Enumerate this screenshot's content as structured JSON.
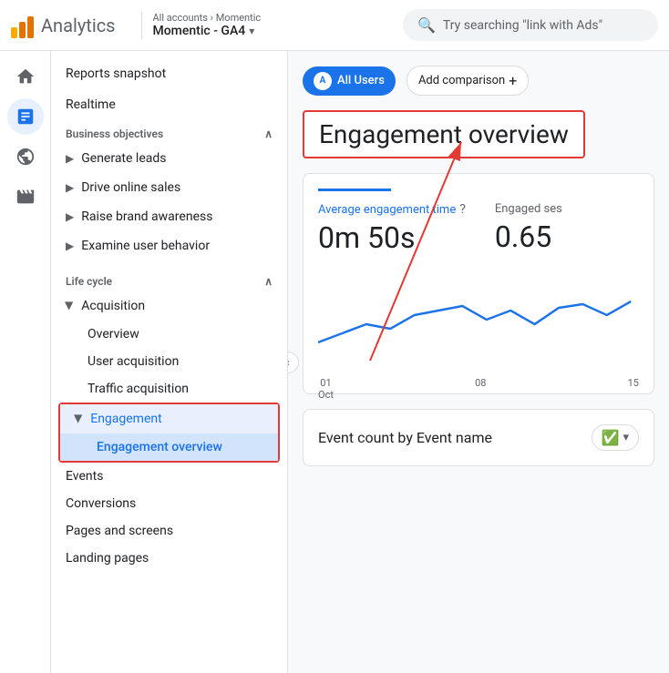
{
  "header": {
    "app_name": "Analytics",
    "breadcrumb": "All accounts › Momentic",
    "property_name": "Momentic - GA4",
    "search_placeholder": "Try searching \"link with Ads\""
  },
  "rail": {
    "icons": [
      {
        "name": "home-icon",
        "symbol": "⌂",
        "active": false
      },
      {
        "name": "reports-icon",
        "symbol": "📊",
        "active": true
      },
      {
        "name": "explore-icon",
        "symbol": "🔍",
        "active": false
      },
      {
        "name": "advertising-icon",
        "symbol": "📡",
        "active": false
      }
    ]
  },
  "sidebar": {
    "top_items": [
      {
        "name": "reports-snapshot",
        "label": "Reports snapshot"
      },
      {
        "name": "realtime",
        "label": "Realtime"
      }
    ],
    "sections": [
      {
        "name": "business-objectives-section",
        "label": "Business objectives",
        "expanded": true,
        "items": [
          {
            "name": "generate-leads",
            "label": "Generate leads",
            "has_arrow": true
          },
          {
            "name": "drive-online-sales",
            "label": "Drive online sales",
            "has_arrow": true
          },
          {
            "name": "raise-brand-awareness",
            "label": "Raise brand awareness",
            "has_arrow": true
          },
          {
            "name": "examine-user-behavior",
            "label": "Examine user behavior",
            "has_arrow": true
          }
        ]
      },
      {
        "name": "life-cycle-section",
        "label": "Life cycle",
        "expanded": true,
        "items": [
          {
            "name": "acquisition",
            "label": "Acquisition",
            "has_arrow": true,
            "expanded": true,
            "sub_items": [
              {
                "name": "overview",
                "label": "Overview"
              },
              {
                "name": "user-acquisition",
                "label": "User acquisition"
              },
              {
                "name": "traffic-acquisition",
                "label": "Traffic acquisition"
              }
            ]
          },
          {
            "name": "engagement",
            "label": "Engagement",
            "has_arrow": true,
            "expanded": true,
            "active": true,
            "sub_items": [
              {
                "name": "engagement-overview",
                "label": "Engagement overview",
                "active": true
              }
            ]
          },
          {
            "name": "events",
            "label": "Events"
          },
          {
            "name": "conversions",
            "label": "Conversions"
          },
          {
            "name": "pages-and-screens",
            "label": "Pages and screens"
          },
          {
            "name": "landing-pages",
            "label": "Landing pages"
          }
        ]
      }
    ]
  },
  "main": {
    "user_segment": "All Users",
    "add_comparison_label": "Add comparison",
    "page_title": "Engagement overview",
    "metrics": [
      {
        "label": "Average engagement time",
        "has_info": true,
        "value": "0m 50s"
      },
      {
        "label": "Engaged ses",
        "has_info": false,
        "value": "0.65"
      }
    ],
    "chart": {
      "x_labels": [
        {
          "line1": "01",
          "line2": "Oct"
        },
        {
          "line1": "08",
          "line2": ""
        },
        {
          "line1": "15",
          "line2": ""
        }
      ]
    },
    "event_card": {
      "title": "Event count by Event name",
      "check_label": ""
    }
  }
}
